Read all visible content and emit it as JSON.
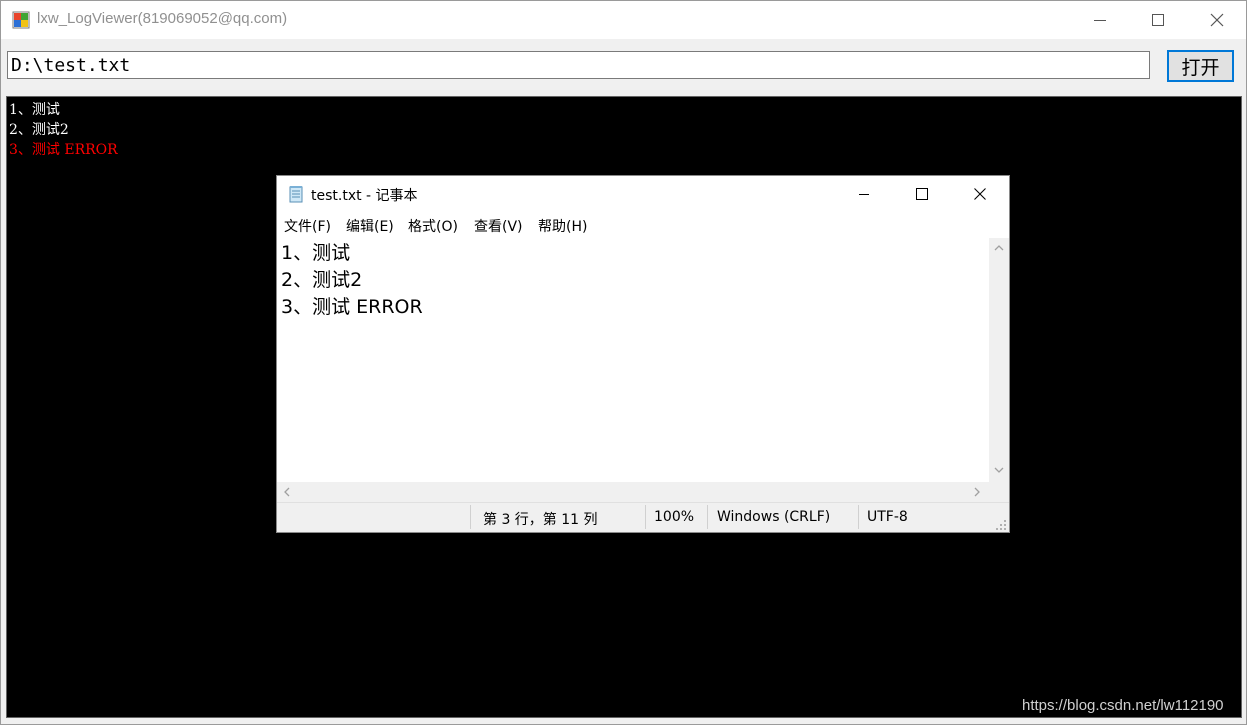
{
  "app": {
    "title": "lxw_LogViewer(819069052@qq.com)"
  },
  "toolbar": {
    "path_value": "D:\\test.txt",
    "open_label": "打开"
  },
  "log": {
    "lines": [
      {
        "text": "1、测试",
        "color": "#ffffff"
      },
      {
        "text": "2、测试2",
        "color": "#ffffff"
      },
      {
        "text": "3、测试 ERROR",
        "color": "#ff0000"
      }
    ]
  },
  "notepad": {
    "title": "test.txt - 记事本",
    "menu": [
      "文件(F)",
      "编辑(E)",
      "格式(O)",
      "查看(V)",
      "帮助(H)"
    ],
    "lines": [
      "1、测试",
      "2、测试2",
      "3、测试 ERROR"
    ],
    "status": {
      "position": "第 3 行，第 11 列",
      "zoom": "100%",
      "line_ending": "Windows (CRLF)",
      "encoding": "UTF-8"
    }
  },
  "watermark": "https://blog.csdn.net/lw112190",
  "colors": {
    "log_background": "#000000",
    "error": "#ff0000",
    "accent": "#0078d7"
  }
}
